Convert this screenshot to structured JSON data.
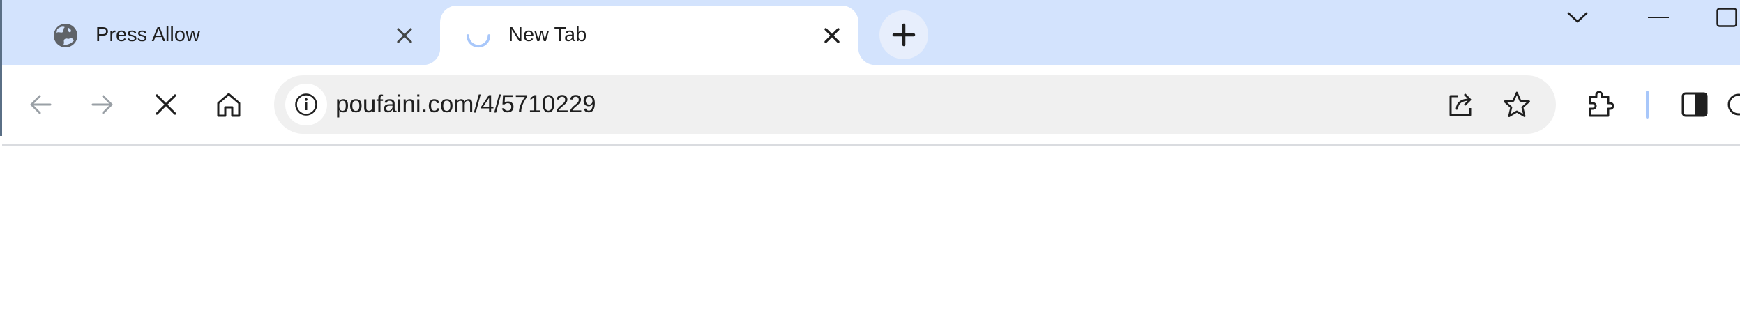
{
  "tabs": [
    {
      "title": "Press Allow",
      "icon": "globe-icon",
      "active": false
    },
    {
      "title": "New Tab",
      "icon": "loading-spinner-icon",
      "active": true
    }
  ],
  "toolbar": {
    "url": "poufaini.com/4/5710229"
  },
  "colors": {
    "tabstrip_bg": "#d3e3fd",
    "omnibox_bg": "#f0f0f0",
    "icon_dark": "#1f1f1f",
    "icon_disabled": "#9aa0a6",
    "accent": "#a8c7fa"
  }
}
